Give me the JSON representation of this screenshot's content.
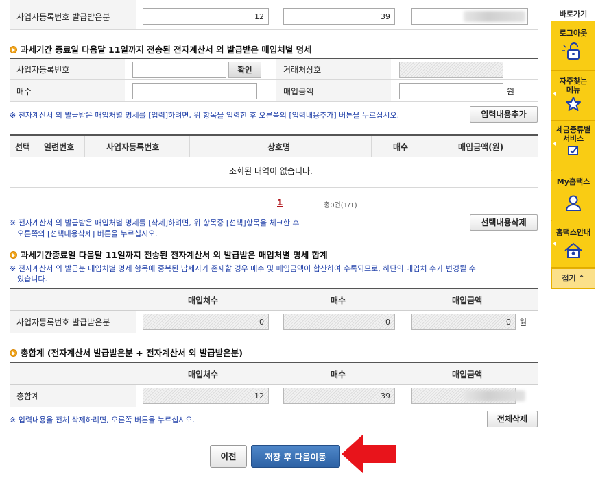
{
  "top_row": {
    "label": "사업자등록번호 발급받은분",
    "count": "12",
    "qty": "39"
  },
  "section1": {
    "title": "과세기간 종료일 다음달 11일까지 전송된 전자계산서 외 발급받은 매입처별 명세",
    "biz_no_label": "사업자등록번호",
    "confirm_button": "확인",
    "trade_name_label": "거래처상호",
    "count_label": "매수",
    "amount_label": "매입금액",
    "won": "원",
    "note_add": "※ 전자계산서 외 발급받은 매입처별 명세를 [입력]하려면, 위 항목을 입력한 후 오른쪽의 [입력내용추가] 버튼을 누르십시오.",
    "add_button": "입력내용추가"
  },
  "list_table": {
    "headers": [
      "선택",
      "일련번호",
      "사업자등록번호",
      "상호명",
      "매수",
      "매입금액(원)"
    ],
    "empty_message": "조회된 내역이 없습니다.",
    "page": "1",
    "total": "총0건(1/1)",
    "note_delete_line1": "※ 전자계산서 외 발급받은 매입처별 명세를 [삭제]하려면, 위 항목중 [선택]항목을 체크한 후",
    "note_delete_line2": "오른쪽의 [선택내용삭제] 버튼을 누르십시오.",
    "delete_button": "선택내용삭제"
  },
  "section2": {
    "title": "과세기간종료일 다음달 11일까지 전송된 전자계산서 외 발급받은 매입처별 명세 합계",
    "note_line1": "※ 전자계산서 외 발급분 매입처별 명세 항목에 중복된 납세자가 존재할 경우 매수 및 매입금액이 합산하여 수록되므로, 하단의 매입처 수가 변경될 수",
    "note_line2": "있습니다.",
    "headers": [
      "매입처수",
      "매수",
      "매입금액"
    ],
    "row_label": "사업자등록번호 발급받은분",
    "vendors": "0",
    "count": "0",
    "amount": "0",
    "won": "원"
  },
  "section3": {
    "title": "총합계 (전자계산서 발급받은분 + 전자계산서 외 발급받은분)",
    "headers": [
      "매입처수",
      "매수",
      "매입금액"
    ],
    "row_label": "총합계",
    "vendors": "12",
    "count": "39",
    "note": "※ 입력내용을 전체 삭제하려면, 오른쪽 버튼을 누르십시오.",
    "delete_all_button": "전체삭제"
  },
  "footer": {
    "prev_button": "이전",
    "save_button": "저장 후 다음이동"
  },
  "sidebar": {
    "title": "바로가기",
    "items": [
      "로그아웃",
      "자주찾는 메뉴",
      "세금종류별 서비스",
      "My홈택스",
      "홈택스안내"
    ],
    "collapse": "접기 ^"
  },
  "colors": {
    "accent_yellow": "#f9cc14",
    "save_blue": "#2d62a5",
    "note_blue": "#1f3fa8",
    "arrow_red": "#e8141b"
  }
}
